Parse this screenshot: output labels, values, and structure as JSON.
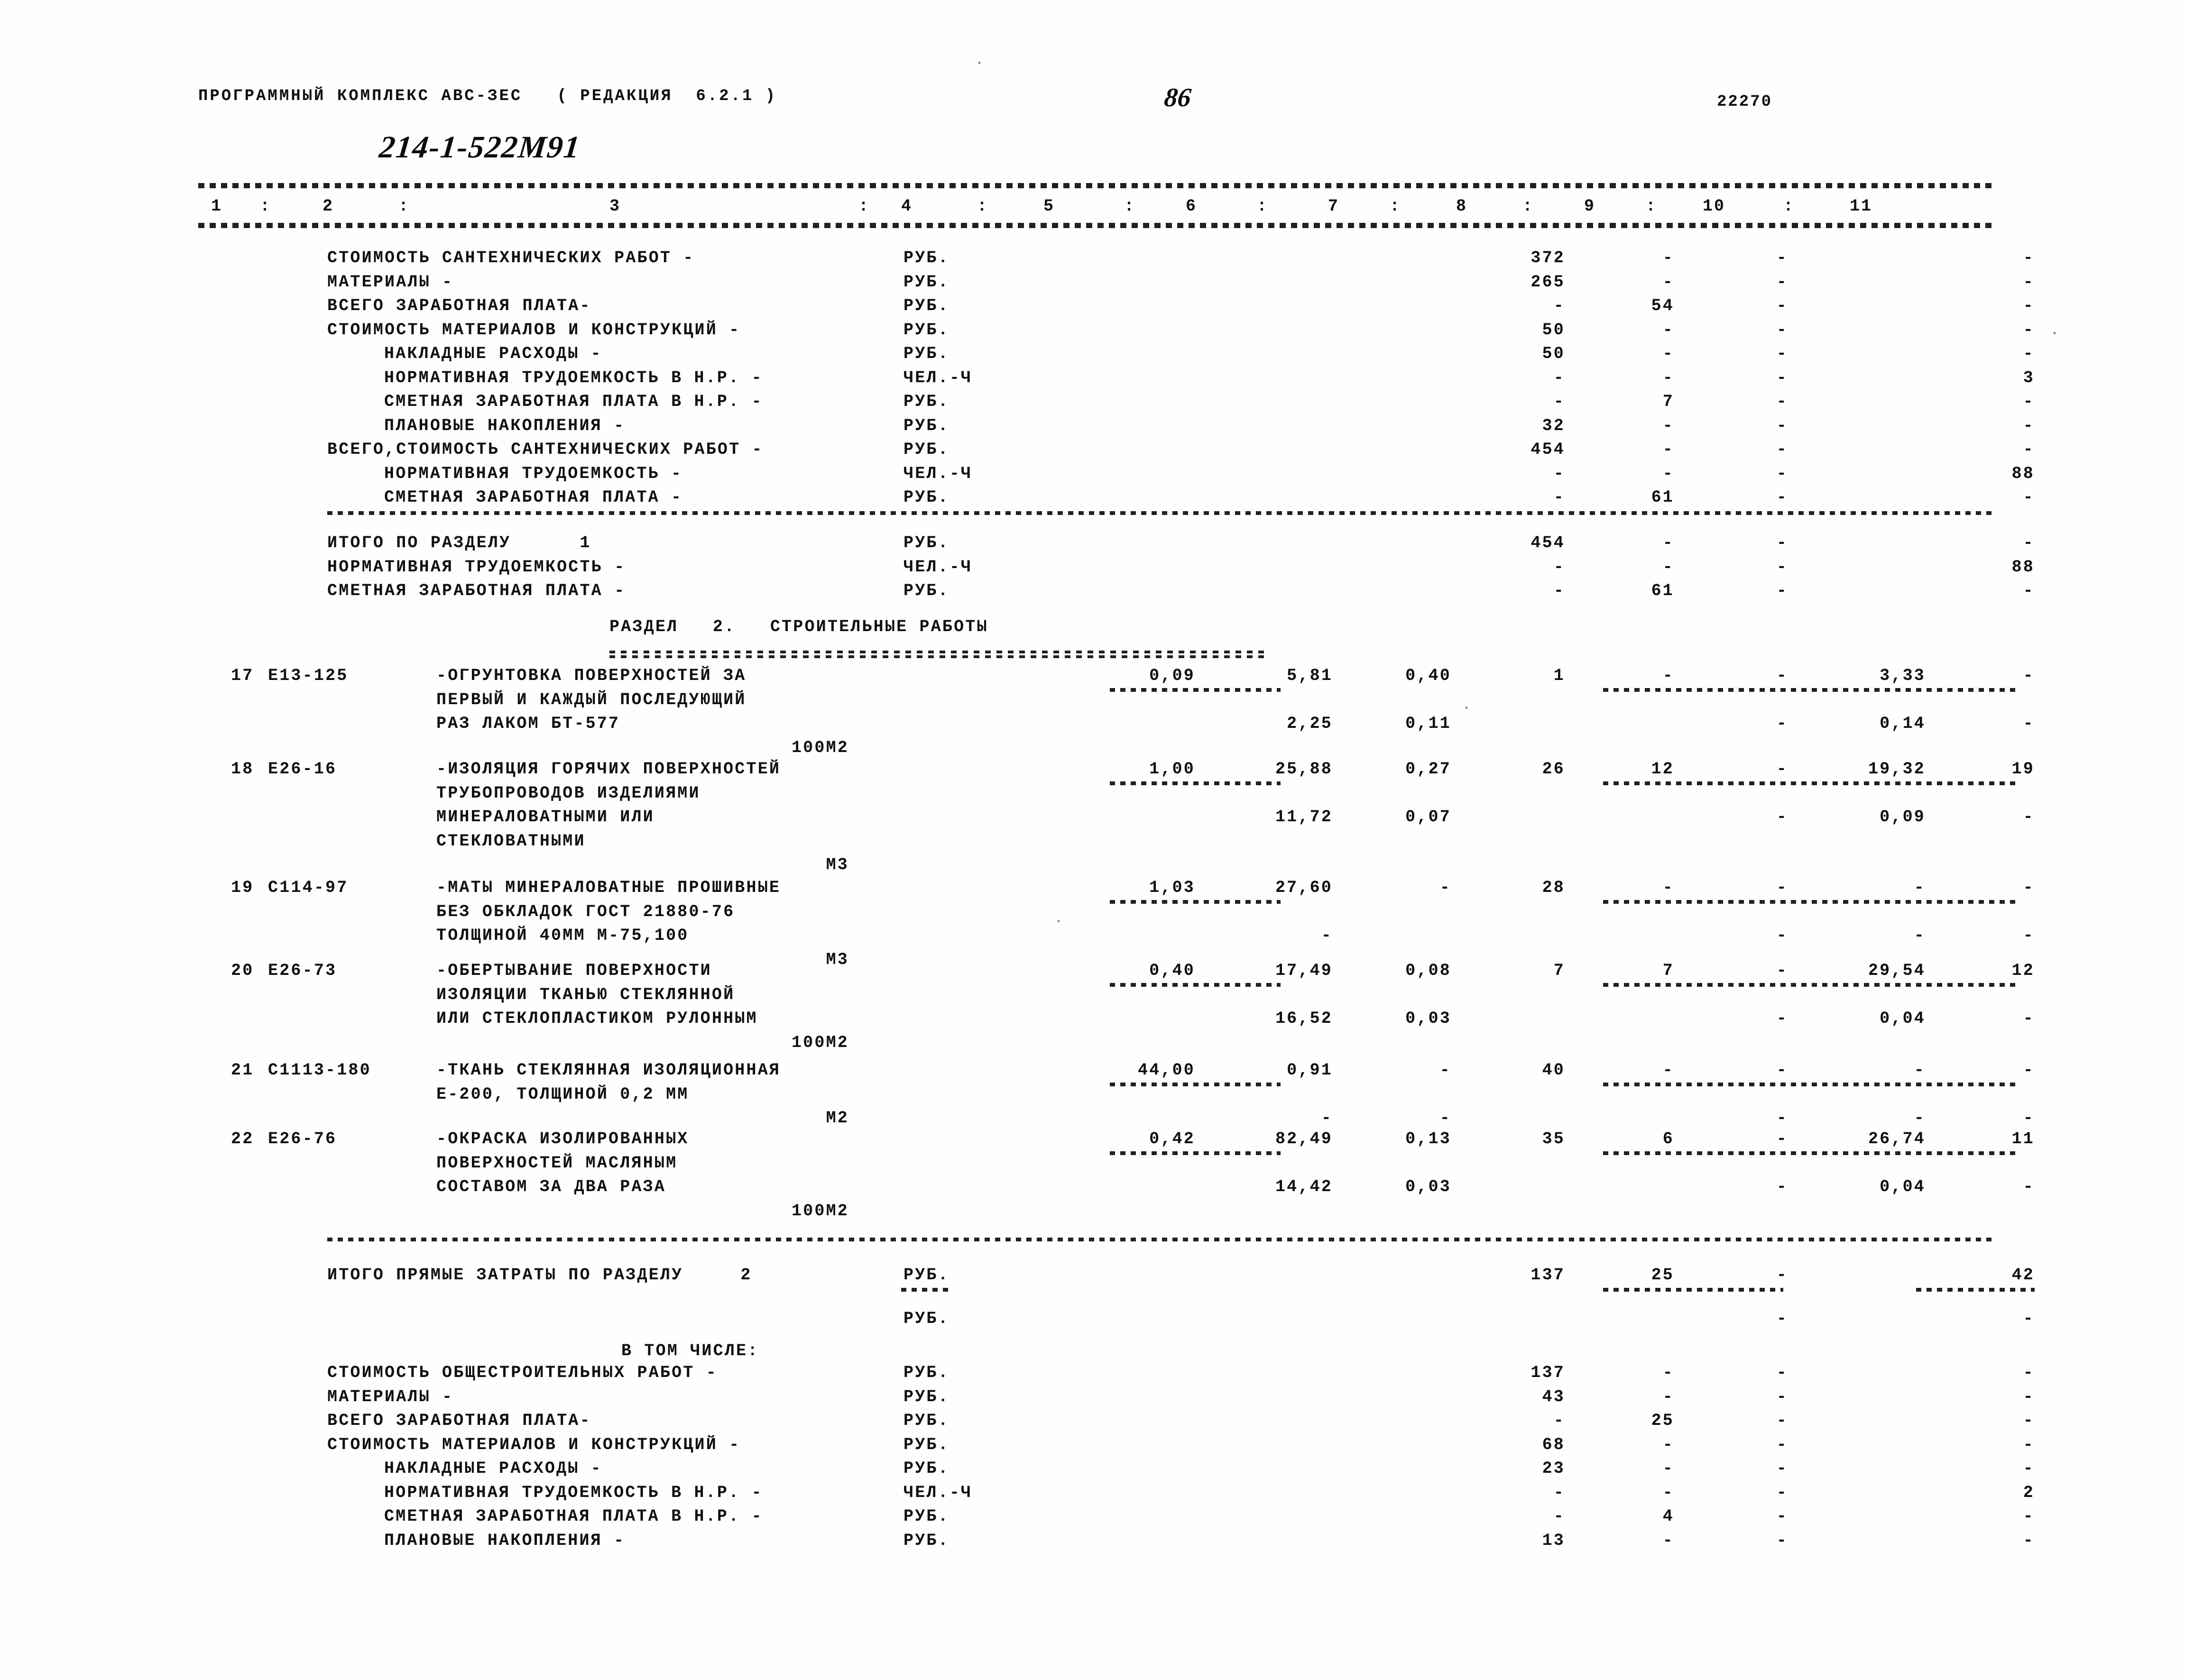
{
  "header": {
    "program_title": "ПРОГРАММНЫЙ КОМПЛЕКС АВС-ЗЕС   ( РЕДАКЦИЯ  6.2.1 )",
    "page_number": "86",
    "document_code": "22270",
    "handwritten_code": "214-1-522М91"
  },
  "columns": {
    "labels": [
      "1",
      "2",
      "3",
      "4",
      "5",
      "6",
      "7",
      "8",
      "9",
      "10",
      "11"
    ],
    "separator": ":"
  },
  "section1_summary": {
    "rows": [
      {
        "label": "СТОИМОСТЬ САНТЕХНИЧЕСКИХ РАБОТ -",
        "unit": "РУБ.",
        "c7": "372",
        "c8": "-",
        "c9": "-",
        "c10": "",
        "c11": "-"
      },
      {
        "label": "МАТЕРИАЛЫ -",
        "unit": "РУБ.",
        "c7": "265",
        "c8": "-",
        "c9": "-",
        "c10": "",
        "c11": "-"
      },
      {
        "label": "ВСЕГО ЗАРАБОТНАЯ ПЛАТА-",
        "unit": "РУБ.",
        "c7": "-",
        "c8": "54",
        "c9": "-",
        "c10": "",
        "c11": "-"
      },
      {
        "label": "СТОИМОСТЬ МАТЕРИАЛОВ И КОНСТРУКЦИЙ -",
        "unit": "РУБ.",
        "c7": "50",
        "c8": "-",
        "c9": "-",
        "c10": "",
        "c11": "-"
      },
      {
        "label": "НАКЛАДНЫЕ РАСХОДЫ -",
        "unit": "РУБ.",
        "c7": "50",
        "c8": "-",
        "c9": "-",
        "c10": "",
        "c11": "-",
        "indent": 1
      },
      {
        "label": "НОРМАТИВНАЯ ТРУДОЕМКОСТЬ В Н.Р. -",
        "unit": "ЧЕЛ.-Ч",
        "c7": "-",
        "c8": "-",
        "c9": "-",
        "c10": "",
        "c11": "3",
        "indent": 1
      },
      {
        "label": "СМЕТНАЯ ЗАРАБОТНАЯ ПЛАТА В Н.Р. -",
        "unit": "РУБ.",
        "c7": "-",
        "c8": "7",
        "c9": "-",
        "c10": "",
        "c11": "-",
        "indent": 1
      },
      {
        "label": "ПЛАНОВЫЕ НАКОПЛЕНИЯ -",
        "unit": "РУБ.",
        "c7": "32",
        "c8": "-",
        "c9": "-",
        "c10": "",
        "c11": "-",
        "indent": 1
      },
      {
        "label": "ВСЕГО,СТОИМОСТЬ САНТЕХНИЧЕСКИХ РАБОТ -",
        "unit": "РУБ.",
        "c7": "454",
        "c8": "-",
        "c9": "-",
        "c10": "",
        "c11": "-"
      },
      {
        "label": "НОРМАТИВНАЯ ТРУДОЕМКОСТЬ -",
        "unit": "ЧЕЛ.-Ч",
        "c7": "-",
        "c8": "-",
        "c9": "-",
        "c10": "",
        "c11": "88",
        "indent": 1
      },
      {
        "label": "СМЕТНАЯ ЗАРАБОТНАЯ ПЛАТА -",
        "unit": "РУБ.",
        "c7": "-",
        "c8": "61",
        "c9": "-",
        "c10": "",
        "c11": "-",
        "indent": 1
      }
    ]
  },
  "section1_total": {
    "rows": [
      {
        "label": "ИТОГО ПО РАЗДЕЛУ      1",
        "unit": "РУБ.",
        "c7": "454",
        "c8": "-",
        "c9": "-",
        "c11": "-"
      },
      {
        "label": "НОРМАТИВНАЯ ТРУДОЕМКОСТЬ -",
        "unit": "ЧЕЛ.-Ч",
        "c7": "-",
        "c8": "-",
        "c9": "-",
        "c11": "88"
      },
      {
        "label": "СМЕТНАЯ ЗАРАБОТНАЯ ПЛАТА -",
        "unit": "РУБ.",
        "c7": "-",
        "c8": "61",
        "c9": "-",
        "c11": "-"
      }
    ]
  },
  "section2": {
    "title": "РАЗДЕЛ   2.   СТРОИТЕЛЬНЫЕ РАБОТЫ",
    "items": [
      {
        "no": "17",
        "code": "Е13-125",
        "desc_lines": [
          "-ОГРУНТОВКА ПОВЕРХНОСТЕЙ ЗА",
          "ПЕРВЫЙ И КАЖДЫЙ ПОСЛЕДУЮЩИЙ",
          "РАЗ ЛАКОМ БТ-577"
        ],
        "unit": "100М2",
        "c4": "0,09",
        "c5": "5,81",
        "c6": "0,40",
        "c7": "1",
        "c8": "-",
        "c9": "-",
        "c10": "3,33",
        "c11": "-",
        "c5b": "2,25",
        "c6b": "0,11",
        "c9b": "-",
        "c10b": "0,14",
        "c11b": "-"
      },
      {
        "no": "18",
        "code": "Е26-16",
        "desc_lines": [
          "-ИЗОЛЯЦИЯ ГОРЯЧИХ ПОВЕРХНОСТЕЙ",
          "ТРУБОПРОВОДОВ ИЗДЕЛИЯМИ",
          "МИНЕРАЛОВАТНЫМИ ИЛИ",
          "СТЕКЛОВАТНЫМИ"
        ],
        "unit": "М3",
        "c4": "1,00",
        "c5": "25,88",
        "c6": "0,27",
        "c7": "26",
        "c8": "12",
        "c9": "-",
        "c10": "19,32",
        "c11": "19",
        "c5b": "11,72",
        "c6b": "0,07",
        "c9b": "-",
        "c10b": "0,09",
        "c11b": "-"
      },
      {
        "no": "19",
        "code": "С114-97",
        "desc_lines": [
          "-МАТЫ МИНЕРАЛОВАТНЫЕ ПРОШИВНЫЕ",
          "БЕЗ ОБКЛАДОК ГОСТ 21880-76",
          "ТОЛЩИНОЙ 40ММ М-75,100"
        ],
        "unit": "М3",
        "c4": "1,03",
        "c5": "27,60",
        "c6": "-",
        "c7": "28",
        "c8": "-",
        "c9": "-",
        "c10": "-",
        "c11": "-",
        "c5b": "-",
        "c6b": "",
        "c9b": "-",
        "c10b": "-",
        "c11b": "-"
      },
      {
        "no": "20",
        "code": "Е26-73",
        "desc_lines": [
          "-ОБЕРТЫВАНИЕ ПОВЕРХНОСТИ",
          "ИЗОЛЯЦИИ ТКАНЬЮ СТЕКЛЯННОЙ",
          "ИЛИ СТЕКЛОПЛАСТИКОМ РУЛОННЫМ"
        ],
        "unit": "100М2",
        "c4": "0,40",
        "c5": "17,49",
        "c6": "0,08",
        "c7": "7",
        "c8": "7",
        "c9": "-",
        "c10": "29,54",
        "c11": "12",
        "c5b": "16,52",
        "c6b": "0,03",
        "c9b": "-",
        "c10b": "0,04",
        "c11b": "-"
      },
      {
        "no": "21",
        "code": "С1113-180",
        "desc_lines": [
          "-ТКАНЬ СТЕКЛЯННАЯ ИЗОЛЯЦИОННАЯ",
          "Е-200, ТОЛЩИНОЙ 0,2 ММ"
        ],
        "unit": "М2",
        "c4": "44,00",
        "c5": "0,91",
        "c6": "-",
        "c7": "40",
        "c8": "-",
        "c9": "-",
        "c10": "-",
        "c11": "-",
        "c5b": "-",
        "c6b": "-",
        "c9b": "-",
        "c10b": "-",
        "c11b": "-"
      },
      {
        "no": "22",
        "code": "Е26-76",
        "desc_lines": [
          "-ОКРАСКА ИЗОЛИРОВАННЫХ",
          "ПОВЕРХНОСТЕЙ МАСЛЯНЫМ",
          "СОСТАВОМ ЗА ДВА РАЗА"
        ],
        "unit": "100М2",
        "c4": "0,42",
        "c5": "82,49",
        "c6": "0,13",
        "c7": "35",
        "c8": "6",
        "c9": "-",
        "c10": "26,74",
        "c11": "11",
        "c5b": "14,42",
        "c6b": "0,03",
        "c9b": "-",
        "c10b": "0,04",
        "c11b": "-"
      }
    ]
  },
  "section2_total": {
    "label": "ИТОГО ПРЯМЫЕ ЗАТРАТЫ ПО РАЗДЕЛУ     2",
    "unit": "РУБ.",
    "unit2": "РУБ.",
    "c7": "137",
    "c8": "25",
    "c9": "-",
    "c11": "42",
    "c9b": "-",
    "c11b": "-",
    "in_total_label": "В ТОМ ЧИСЛЕ:"
  },
  "section2_summary": {
    "rows": [
      {
        "label": "СТОИМОСТЬ ОБЩЕСТРОИТЕЛЬНЫХ РАБОТ -",
        "unit": "РУБ.",
        "c7": "137",
        "c8": "-",
        "c9": "-",
        "c11": "-"
      },
      {
        "label": "МАТЕРИАЛЫ -",
        "unit": "РУБ.",
        "c7": "43",
        "c8": "-",
        "c9": "-",
        "c11": "-"
      },
      {
        "label": "ВСЕГО ЗАРАБОТНАЯ ПЛАТА-",
        "unit": "РУБ.",
        "c7": "-",
        "c8": "25",
        "c9": "-",
        "c11": "-"
      },
      {
        "label": "СТОИМОСТЬ МАТЕРИАЛОВ И КОНСТРУКЦИЙ -",
        "unit": "РУБ.",
        "c7": "68",
        "c8": "-",
        "c9": "-",
        "c11": "-"
      },
      {
        "label": "НАКЛАДНЫЕ РАСХОДЫ -",
        "unit": "РУБ.",
        "c7": "23",
        "c8": "-",
        "c9": "-",
        "c11": "-",
        "indent": 1
      },
      {
        "label": "НОРМАТИВНАЯ ТРУДОЕМКОСТЬ В Н.Р. -",
        "unit": "ЧЕЛ.-Ч",
        "c7": "-",
        "c8": "-",
        "c9": "-",
        "c11": "2",
        "indent": 1
      },
      {
        "label": "СМЕТНАЯ ЗАРАБОТНАЯ ПЛАТА В Н.Р. -",
        "unit": "РУБ.",
        "c7": "-",
        "c8": "4",
        "c9": "-",
        "c11": "-",
        "indent": 1
      },
      {
        "label": "ПЛАНОВЫЕ НАКОПЛЕНИЯ -",
        "unit": "РУБ.",
        "c7": "13",
        "c8": "-",
        "c9": "-",
        "c11": "-",
        "indent": 1
      }
    ]
  }
}
